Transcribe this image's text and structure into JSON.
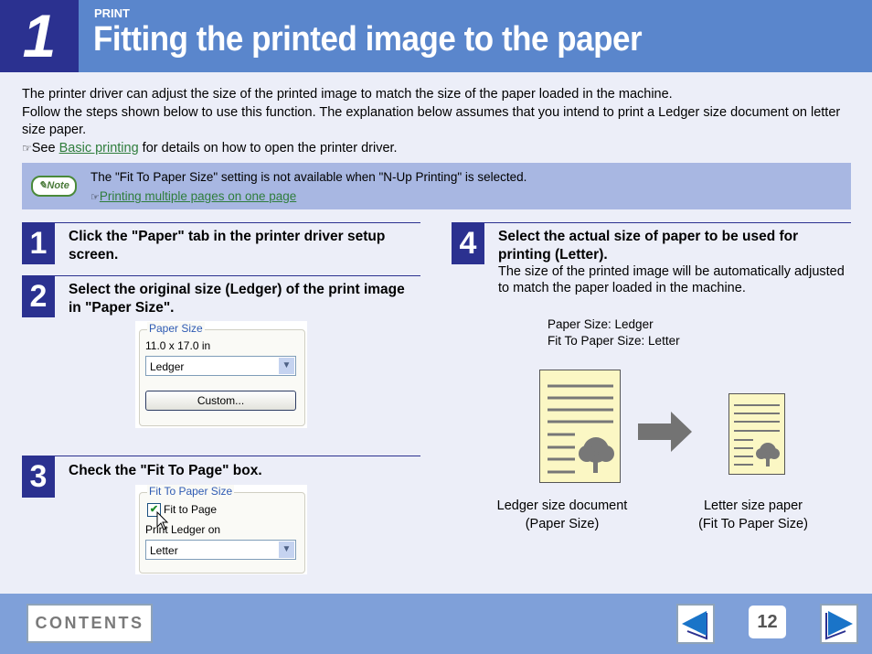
{
  "header": {
    "chapter_number": "1",
    "section": "PRINT",
    "title": "Fitting the printed image to the paper"
  },
  "intro": {
    "line1": "The printer driver can adjust the size of the printed image to match the size of the paper loaded in the machine.",
    "line2": "Follow the steps shown below to use this function. The explanation below assumes that you intend to print a Ledger size document on letter size paper.",
    "see_prefix": "See ",
    "see_link": "Basic printing",
    "see_suffix": " for details on how to open the printer driver.",
    "ref_icon": "☞"
  },
  "note": {
    "badge": "Note",
    "text": "The \"Fit To Paper Size\" setting is not available when \"N-Up Printing\" is selected.",
    "link": "Printing multiple pages on one page",
    "ref_icon": "☞"
  },
  "steps": [
    {
      "number": "1",
      "text": "Click the \"Paper\" tab in the printer driver setup screen."
    },
    {
      "number": "2",
      "text": "Select the original size (Ledger) of the print image in \"Paper Size\"."
    },
    {
      "number": "3",
      "text": "Check the \"Fit To Page\" box."
    },
    {
      "number": "4",
      "text": "Select the actual size of paper to be used for printing (Letter).",
      "subtext": "The size of the printed image will be automatically adjusted to match the paper loaded in the machine."
    }
  ],
  "paper_size_panel": {
    "legend": "Paper Size",
    "dimensions": "11.0 x 17.0 in",
    "selected": "Ledger",
    "custom_button": "Custom..."
  },
  "fit_panel": {
    "legend": "Fit To Paper Size",
    "checkbox_label": "Fit to Page",
    "checked": true,
    "print_on_label": "Print Ledger on",
    "selected": "Letter"
  },
  "illustration": {
    "setting1": "Paper Size: Ledger",
    "setting2": "Fit To Paper Size: Letter",
    "left_caption1": "Ledger size document",
    "left_caption2": "(Paper Size)",
    "right_caption1": "Letter size paper",
    "right_caption2": "(Fit To Paper Size)"
  },
  "footer": {
    "contents_label": "CONTENTS",
    "page_number": "12",
    "prev_icon": "left-arrow-icon",
    "next_icon": "right-arrow-icon"
  }
}
